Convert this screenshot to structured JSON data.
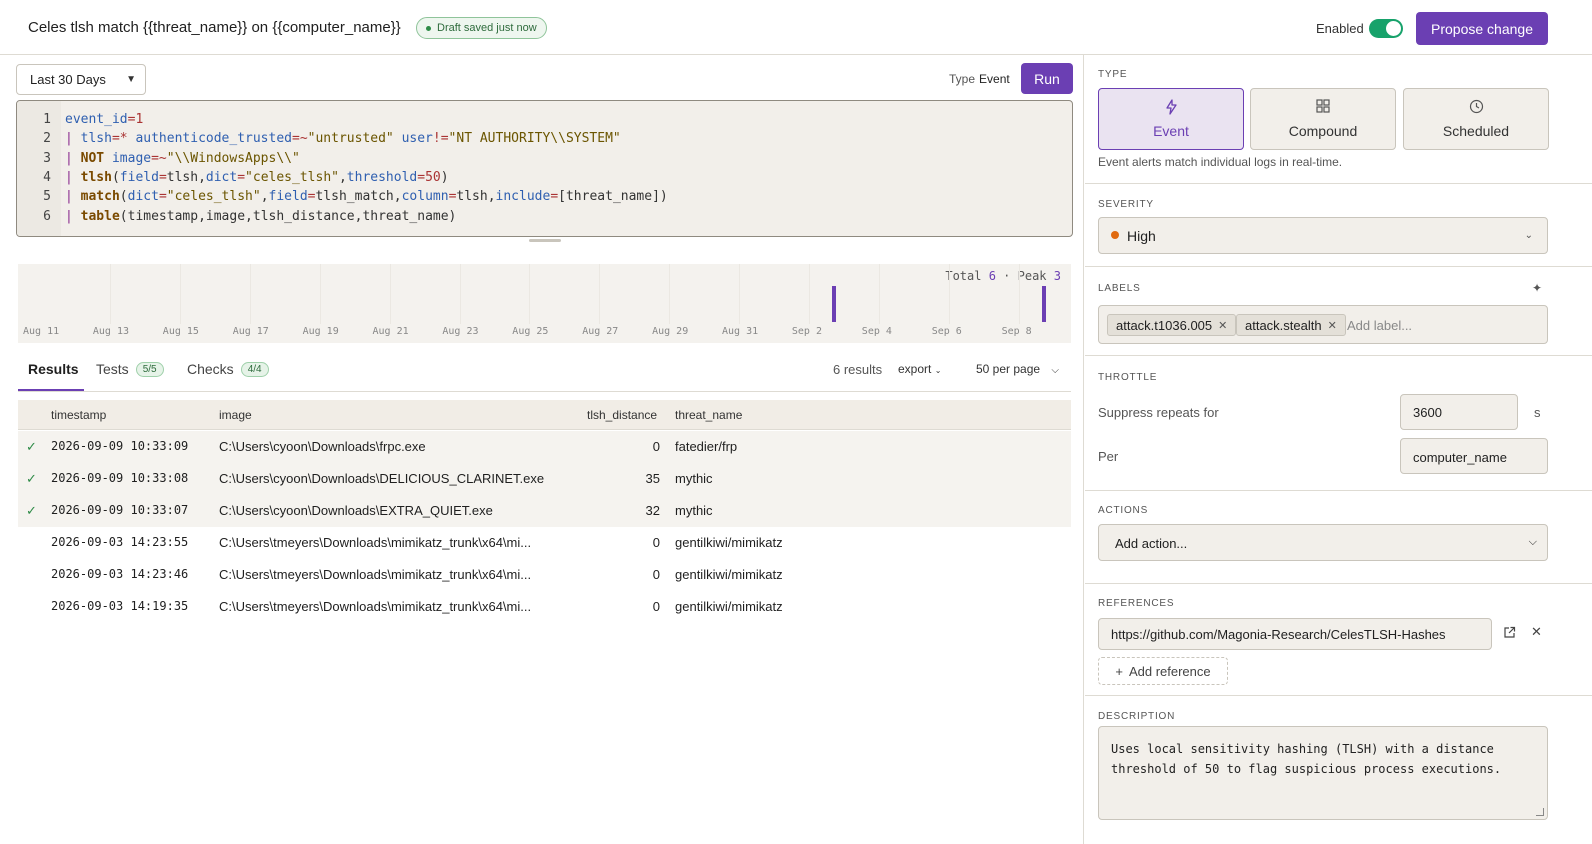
{
  "header": {
    "title": "Celes tlsh match {{threat_name}} on {{computer_name}}",
    "draft_status": "Draft saved just now",
    "enabled_label": "Enabled",
    "enabled": true,
    "propose_label": "Propose change"
  },
  "query": {
    "time_range": "Last 30 Days",
    "type_label": "Type",
    "type_value": "Event",
    "run_label": "Run",
    "lines": [
      {
        "n": "1",
        "text": "event_id=1"
      },
      {
        "n": "2",
        "text": "| tlsh=* authenticode_trusted=~\"untrusted\" user!=\"NT AUTHORITY\\\\SYSTEM\""
      },
      {
        "n": "3",
        "text": "| NOT image=~\"\\\\WindowsApps\\\\\""
      },
      {
        "n": "4",
        "text": "| tlsh(field=tlsh,dict=\"celes_tlsh\",threshold=50)"
      },
      {
        "n": "5",
        "text": "| match(dict=\"celes_tlsh\",field=tlsh_match,column=tlsh,include=[threat_name])"
      },
      {
        "n": "6",
        "text": "| table(timestamp,image,tlsh_distance,threat_name)"
      }
    ]
  },
  "histogram": {
    "total_label": "Total",
    "total": "6",
    "peak_label": "Peak",
    "peak": "3",
    "ticks": [
      "Aug 11",
      "Aug 13",
      "Aug 15",
      "Aug 17",
      "Aug 19",
      "Aug 21",
      "Aug 23",
      "Aug 25",
      "Aug 27",
      "Aug 29",
      "Aug 31",
      "Sep 2",
      "Sep 4",
      "Sep 6",
      "Sep 8"
    ],
    "bars": [
      {
        "date": "Sep 3",
        "count": 3
      },
      {
        "date": "Sep 9",
        "count": 3
      }
    ],
    "accent": "#6b3fb3"
  },
  "tabs": {
    "results": "Results",
    "tests": "Tests",
    "tests_badge": "5/5",
    "checks": "Checks",
    "checks_badge": "4/4",
    "results_count": "6 results",
    "export": "export",
    "per_page": "50 per page"
  },
  "table": {
    "columns": [
      "timestamp",
      "image",
      "tlsh_distance",
      "threat_name"
    ],
    "rows": [
      {
        "checked": true,
        "timestamp": "2026-09-09 10:33:09",
        "image": "C:\\Users\\cyoon\\Downloads\\frpc.exe",
        "tlsh_distance": "0",
        "threat_name": "fatedier/frp"
      },
      {
        "checked": true,
        "timestamp": "2026-09-09 10:33:08",
        "image": "C:\\Users\\cyoon\\Downloads\\DELICIOUS_CLARINET.exe",
        "tlsh_distance": "35",
        "threat_name": "mythic"
      },
      {
        "checked": true,
        "timestamp": "2026-09-09 10:33:07",
        "image": "C:\\Users\\cyoon\\Downloads\\EXTRA_QUIET.exe",
        "tlsh_distance": "32",
        "threat_name": "mythic"
      },
      {
        "checked": false,
        "timestamp": "2026-09-03 14:23:55",
        "image": "C:\\Users\\tmeyers\\Downloads\\mimikatz_trunk\\x64\\mi...",
        "tlsh_distance": "0",
        "threat_name": "gentilkiwi/mimikatz"
      },
      {
        "checked": false,
        "timestamp": "2026-09-03 14:23:46",
        "image": "C:\\Users\\tmeyers\\Downloads\\mimikatz_trunk\\x64\\mi...",
        "tlsh_distance": "0",
        "threat_name": "gentilkiwi/mimikatz"
      },
      {
        "checked": false,
        "timestamp": "2026-09-03 14:19:35",
        "image": "C:\\Users\\tmeyers\\Downloads\\mimikatz_trunk\\x64\\mi...",
        "tlsh_distance": "0",
        "threat_name": "gentilkiwi/mimikatz"
      }
    ]
  },
  "panel": {
    "type_title": "TYPE",
    "types": [
      {
        "label": "Event",
        "icon": "bolt-icon",
        "active": true
      },
      {
        "label": "Compound",
        "icon": "grid-icon",
        "active": false
      },
      {
        "label": "Scheduled",
        "icon": "clock-icon",
        "active": false
      }
    ],
    "type_help": "Event alerts match individual logs in real-time.",
    "severity_title": "SEVERITY",
    "severity": "High",
    "severity_color": "#e06a10",
    "labels_title": "LABELS",
    "labels": [
      "attack.t1036.005",
      "attack.stealth"
    ],
    "labels_placeholder": "Add label...",
    "throttle_title": "THROTTLE",
    "suppress_label": "Suppress repeats for",
    "suppress_value": "3600",
    "suppress_unit": "s",
    "per_label": "Per",
    "per_value": "computer_name",
    "actions_title": "ACTIONS",
    "actions_value": "Add action...",
    "references_title": "REFERENCES",
    "reference_url": "https://github.com/Magonia-Research/CelesTLSH-Hashes",
    "add_reference": "Add reference",
    "description_title": "DESCRIPTION",
    "description": "Uses local sensitivity hashing (TLSH) with a distance threshold of 50 to flag suspicious process executions."
  }
}
